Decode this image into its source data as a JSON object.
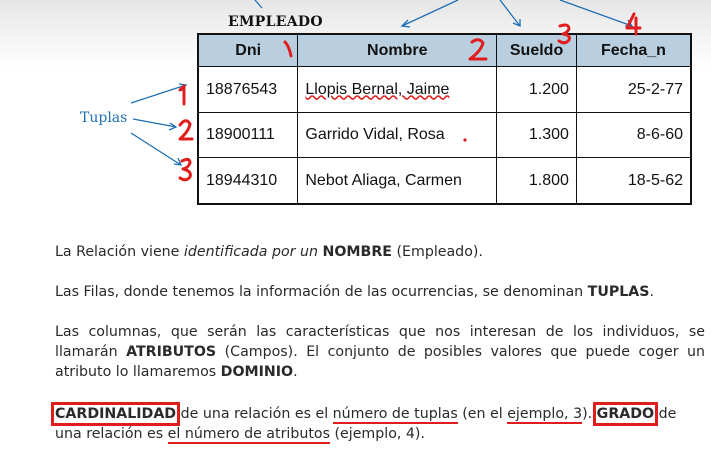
{
  "table": {
    "title": "EMPLEADO",
    "columns": [
      "Dni",
      "Nombre",
      "Sueldo",
      "Fecha_n"
    ],
    "rows": [
      [
        "18876543",
        "Llopis Bernal, Jaime",
        "1.200",
        "25-2-77"
      ],
      [
        "18900111",
        "Garrido Vidal, Rosa",
        "1.300",
        "8-6-60"
      ],
      [
        "18944310",
        "Nebot Aliaga, Carmen",
        "1.800",
        "18-5-62"
      ]
    ]
  },
  "tuplas_label": "Tuplas",
  "annotations": {
    "column_numbers": [
      "1",
      "2",
      "3",
      "4"
    ],
    "row_numbers": [
      "1",
      "2",
      "3"
    ]
  },
  "paragraphs": {
    "p1": {
      "pre": "La Relación viene ",
      "italic": "identificada por un ",
      "bold": "NOMBRE",
      "post": " (Empleado)."
    },
    "p2": {
      "pre": "Las Filas, donde tenemos la información de las ocurrencias, se denominan ",
      "bold": "TUPLAS",
      "post": "."
    },
    "p3": {
      "pre": "Las columnas, que serán las características que nos interesan de los individuos, se llamarán ",
      "bold1": "ATRIBUTOS",
      "mid": " (Campos). El conjunto de posibles valores que puede coger un atributo lo llamaremos ",
      "bold2": "DOMINIO",
      "post": "."
    },
    "p4": {
      "bold1": "CARDINALIDAD",
      "t1": " de una relación es el ",
      "u1": "número de tuplas",
      "t2": " (en el ",
      "u2": "ejemplo, 3",
      "t3": "). ",
      "bold2": "GRADO",
      "t4": " de una relación es ",
      "u3": "el número de atributos",
      "t5": " (ejemplo, 4)."
    }
  },
  "colors": {
    "header_fill": "#b9cfe0",
    "annotation_red": "#e01d1d",
    "arrow_blue": "#1f6fb5"
  }
}
